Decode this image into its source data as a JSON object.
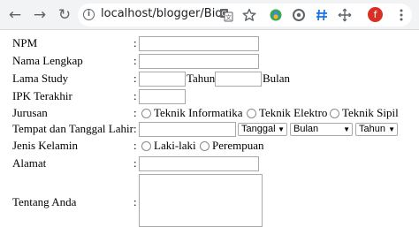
{
  "browser": {
    "url": "localhost/blogger/Bio...",
    "back_glyph": "←",
    "forward_glyph": "→",
    "reload_glyph": "↻",
    "info_glyph": "i",
    "profile_initial": "f"
  },
  "form": {
    "npm": {
      "label": "NPM",
      "colon": ":"
    },
    "nama": {
      "label": "Nama Lengkap",
      "colon": ":"
    },
    "lama": {
      "label": "Lama Study",
      "colon": ":",
      "tahun_label": "Tahun",
      "bulan_label": "Bulan"
    },
    "ipk": {
      "label": "IPK Terakhir",
      "colon": ":"
    },
    "jurusan": {
      "label": "Jurusan",
      "colon": ":",
      "options": [
        "Teknik Informatika",
        "Teknik Elektro",
        "Teknik Sipil"
      ]
    },
    "ttl": {
      "label": "Tempat dan Tanggal Lahir",
      "colon": ":",
      "tanggal_select": "Tanggal",
      "bulan_select": "Bulan",
      "tahun_select": "Tahun"
    },
    "jenis_kelamin": {
      "label": "Jenis Kelamin",
      "colon": ":",
      "options": [
        "Laki-laki",
        "Perempuan"
      ]
    },
    "alamat": {
      "label": "Alamat",
      "colon": ":"
    },
    "tentang": {
      "label": "Tentang Anda",
      "colon": ":"
    }
  },
  "colors": {
    "toolbar": "#f1f3f4",
    "profile_avatar": "#d93025"
  }
}
